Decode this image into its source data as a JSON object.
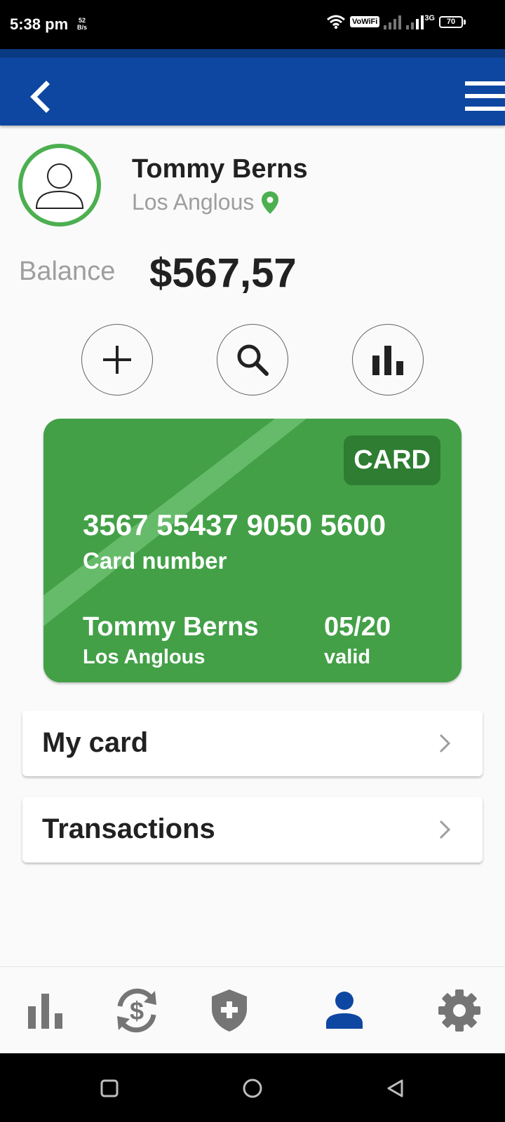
{
  "status_bar": {
    "time": "5:38 pm",
    "net_speed_value": "52",
    "net_speed_unit": "B/s",
    "vowifi": "VoWiFi",
    "network_type": "3G",
    "battery": "70"
  },
  "header": {
    "back_icon": "chevron-left-icon",
    "menu_icon": "hamburger-menu-icon"
  },
  "profile": {
    "name": "Tommy Berns",
    "location": "Los Anglous",
    "location_icon": "map-pin-icon"
  },
  "balance": {
    "label": "Balance",
    "value": "$567,57"
  },
  "actions": [
    {
      "icon": "plus-icon"
    },
    {
      "icon": "search-icon"
    },
    {
      "icon": "bar-chart-icon"
    }
  ],
  "card": {
    "badge": "CARD",
    "number": "3567 55437 9050 5600",
    "number_label": "Card number",
    "holder": "Tommy Berns",
    "city": "Los Anglous",
    "expiry": "05/20",
    "expiry_label": "valid"
  },
  "list": [
    {
      "label": "My card"
    },
    {
      "label": "Transactions"
    }
  ],
  "bottom_nav": {
    "items": [
      {
        "icon": "bar-chart-icon"
      },
      {
        "icon": "currency-exchange-icon"
      },
      {
        "icon": "shield-plus-icon"
      },
      {
        "icon": "person-icon",
        "active": true
      },
      {
        "icon": "gear-icon"
      }
    ],
    "active_color": "#0d47a1",
    "inactive_color": "#757575"
  },
  "colors": {
    "app_bar": "#0d47a1",
    "accent_green": "#4caf50",
    "card_green": "#43a047",
    "badge_green": "#2e7d32"
  }
}
